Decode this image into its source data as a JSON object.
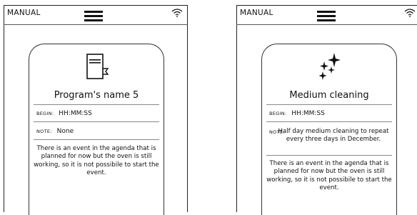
{
  "screens": [
    {
      "mode": "MANUAL",
      "icon": "program-book-icon",
      "title": "Program's name 5",
      "begin_key": "BEGIN:",
      "begin_value": "HH:MM:SS",
      "note_key": "NOTE:",
      "note_value": "None",
      "message": "There is an event in the agenda that is planned for now but the oven is still working, so it is not possibile to start the event."
    },
    {
      "mode": "MANUAL",
      "icon": "sparkle-icon",
      "title": "Medium cleaning",
      "begin_key": "BEGIN:",
      "begin_value": "HH:MM:SS",
      "note_key": "NOTE:",
      "note_value": "Half day medium cleaning to repeat every three days in December.",
      "message": "There is an event in the agenda that is planned for now but the oven is still working, so it is not possibile to start the event."
    }
  ]
}
